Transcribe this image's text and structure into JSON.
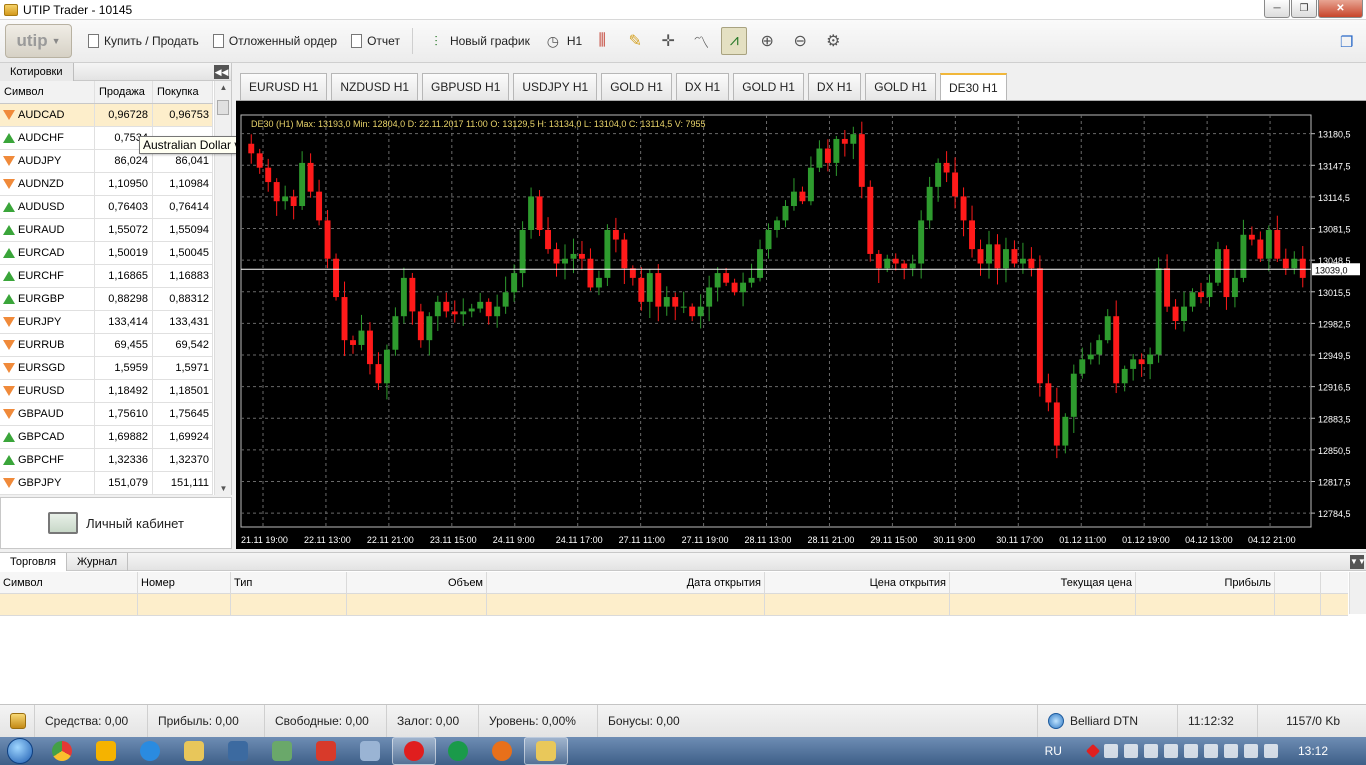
{
  "window": {
    "title": "UTIP Trader - 10145",
    "minimize": "─",
    "maximize": "❐",
    "close": "✕"
  },
  "toolbar": {
    "logo": "utip",
    "buy_sell": "Купить / Продать",
    "pending_order": "Отложенный ордер",
    "report": "Отчет",
    "new_chart": "Новый график",
    "timeframe": "H1"
  },
  "quotes": {
    "tab": "Котировки",
    "columns": [
      "Символ",
      "Продажа",
      "Покупка"
    ],
    "rows": [
      {
        "symbol": "AUDCAD",
        "bid": "0,96728",
        "ask": "0,96753",
        "dir": "down",
        "selected": true
      },
      {
        "symbol": "AUDCHF",
        "bid": "0,7534",
        "ask": "",
        "dir": "up"
      },
      {
        "symbol": "AUDJPY",
        "bid": "86,024",
        "ask": "86,041",
        "dir": "down"
      },
      {
        "symbol": "AUDNZD",
        "bid": "1,10950",
        "ask": "1,10984",
        "dir": "down"
      },
      {
        "symbol": "AUDUSD",
        "bid": "0,76403",
        "ask": "0,76414",
        "dir": "up"
      },
      {
        "symbol": "EURAUD",
        "bid": "1,55072",
        "ask": "1,55094",
        "dir": "up"
      },
      {
        "symbol": "EURCAD",
        "bid": "1,50019",
        "ask": "1,50045",
        "dir": "up"
      },
      {
        "symbol": "EURCHF",
        "bid": "1,16865",
        "ask": "1,16883",
        "dir": "up"
      },
      {
        "symbol": "EURGBP",
        "bid": "0,88298",
        "ask": "0,88312",
        "dir": "up"
      },
      {
        "symbol": "EURJPY",
        "bid": "133,414",
        "ask": "133,431",
        "dir": "down"
      },
      {
        "symbol": "EURRUB",
        "bid": "69,455",
        "ask": "69,542",
        "dir": "down"
      },
      {
        "symbol": "EURSGD",
        "bid": "1,5959",
        "ask": "1,5971",
        "dir": "down"
      },
      {
        "symbol": "EURUSD",
        "bid": "1,18492",
        "ask": "1,18501",
        "dir": "down"
      },
      {
        "symbol": "GBPAUD",
        "bid": "1,75610",
        "ask": "1,75645",
        "dir": "down"
      },
      {
        "symbol": "GBPCAD",
        "bid": "1,69882",
        "ask": "1,69924",
        "dir": "up"
      },
      {
        "symbol": "GBPCHF",
        "bid": "1,32336",
        "ask": "1,32370",
        "dir": "up"
      },
      {
        "symbol": "GBPJPY",
        "bid": "151,079",
        "ask": "151,111",
        "dir": "down"
      }
    ],
    "tooltip": "Australian Dollar vs Canadian Dollar"
  },
  "cabinet": {
    "label": "Личный кабинет"
  },
  "chart_tabs": [
    {
      "label": "EURUSD  H1"
    },
    {
      "label": "NZDUSD  H1"
    },
    {
      "label": "GBPUSD  H1"
    },
    {
      "label": "USDJPY  H1"
    },
    {
      "label": "GOLD  H1"
    },
    {
      "label": "DX  H1"
    },
    {
      "label": "GOLD  H1"
    },
    {
      "label": "DX  H1"
    },
    {
      "label": "GOLD  H1"
    },
    {
      "label": "DE30  H1",
      "active": true
    }
  ],
  "chart_data": {
    "type": "candlestick",
    "info_line": "DE30 (H1)  Max: 13193,0  Min: 12804,0  D: 22.11.2017 11:00  O: 13129,5  H: 13134,0  L: 13104,0  C: 13114,5  V: 7955",
    "symbol": "DE30",
    "timeframe": "H1",
    "ylim": [
      12770,
      13200
    ],
    "y_ticks": [
      "13180,5",
      "13147,5",
      "13114,5",
      "13081,5",
      "13048,5",
      "13015,5",
      "12982,5",
      "12949,5",
      "12916,5",
      "12883,5",
      "12850,5",
      "12817,5",
      "12784,5"
    ],
    "y_tick_values": [
      13180.5,
      13147.5,
      13114.5,
      13081.5,
      13048.5,
      13015.5,
      12982.5,
      12949.5,
      12916.5,
      12883.5,
      12850.5,
      12817.5,
      12784.5
    ],
    "x_ticks": [
      "21.11 19:00",
      "22.11 13:00",
      "22.11 21:00",
      "23.11 15:00",
      "24.11 9:00",
      "24.11 17:00",
      "27.11 11:00",
      "27.11 19:00",
      "28.11 13:00",
      "28.11 21:00",
      "29.11 15:00",
      "30.11 9:00",
      "30.11 17:00",
      "01.12 11:00",
      "01.12 19:00",
      "04.12 13:00",
      "04.12 21:00"
    ],
    "current_price": "13039,0",
    "current_price_value": 13039,
    "up_color": "#2e9b2e",
    "down_color": "#ff1a1a",
    "grid": true,
    "closes": [
      13160,
      13145,
      13130,
      13110,
      13115,
      13105,
      13150,
      13120,
      13090,
      13050,
      13010,
      12965,
      12960,
      12975,
      12940,
      12920,
      12955,
      12990,
      13030,
      12995,
      12965,
      12990,
      13005,
      12995,
      12992,
      12995,
      12998,
      13005,
      12990,
      13000,
      13015,
      13035,
      13080,
      13115,
      13080,
      13060,
      13045,
      13050,
      13055,
      13050,
      13020,
      13030,
      13080,
      13070,
      13040,
      13030,
      13005,
      13035,
      13000,
      13010,
      13000,
      13000,
      12990,
      13000,
      13020,
      13035,
      13025,
      13015,
      13025,
      13030,
      13060,
      13080,
      13090,
      13105,
      13120,
      13110,
      13145,
      13165,
      13150,
      13175,
      13170,
      13180,
      13125,
      13055,
      13040,
      13050,
      13045,
      13040,
      13045,
      13090,
      13125,
      13150,
      13140,
      13115,
      13090,
      13060,
      13045,
      13065,
      13040,
      13060,
      13045,
      13050,
      13040,
      12920,
      12900,
      12855,
      12885,
      12930,
      12945,
      12950,
      12965,
      12990,
      12920,
      12935,
      12945,
      12940,
      12950,
      13040,
      13000,
      12985,
      13000,
      13015,
      13010,
      13025,
      13060,
      13010,
      13030,
      13075,
      13070,
      13050,
      13080,
      13050,
      13040,
      13050,
      13030
    ]
  },
  "bottom": {
    "tabs": [
      "Торговля",
      "Журнал"
    ],
    "columns": [
      "Символ",
      "Номер",
      "Тип",
      "Объем",
      "Дата открытия",
      "Цена открытия",
      "Текущая цена",
      "Прибыль"
    ]
  },
  "status": {
    "funds": "Средства: 0,00",
    "profit": "Прибыль: 0,00",
    "free": "Свободные: 0,00",
    "margin": "Залог: 0,00",
    "level": "Уровень: 0,00%",
    "bonus": "Бонусы: 0,00",
    "server": "Belliard DTN",
    "time": "11:12:32",
    "traffic": "1157/0 Kb"
  },
  "taskbar": {
    "lang": "RU",
    "clock": "13:12"
  }
}
